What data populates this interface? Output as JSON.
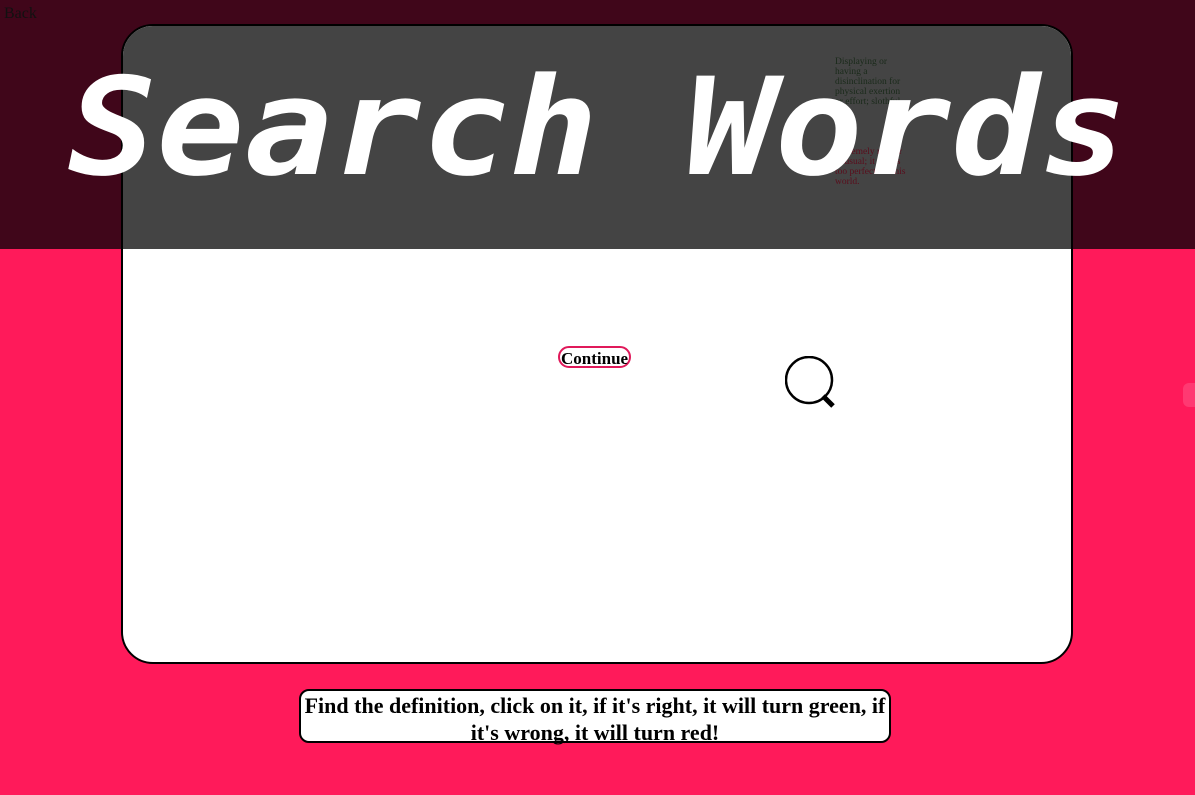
{
  "nav": {
    "back_label": "Back"
  },
  "title": "Search Words",
  "definitions": [
    "Displaying or having a disinclination for physical exertion or effort; slothful.",
    "Extremely rare or unusual; it seems too perfect for this world."
  ],
  "continue_label": "Continue",
  "instructions": "Find the definition, click on it, if it's right, it will turn green, if it's wrong, it will turn red!",
  "colors": {
    "background_pink": "#ff1a5a",
    "background_dark": "#40061a",
    "overlay_gray": "#444444",
    "button_border": "#e0195a"
  },
  "icons": {
    "magnifier": "search-icon"
  }
}
